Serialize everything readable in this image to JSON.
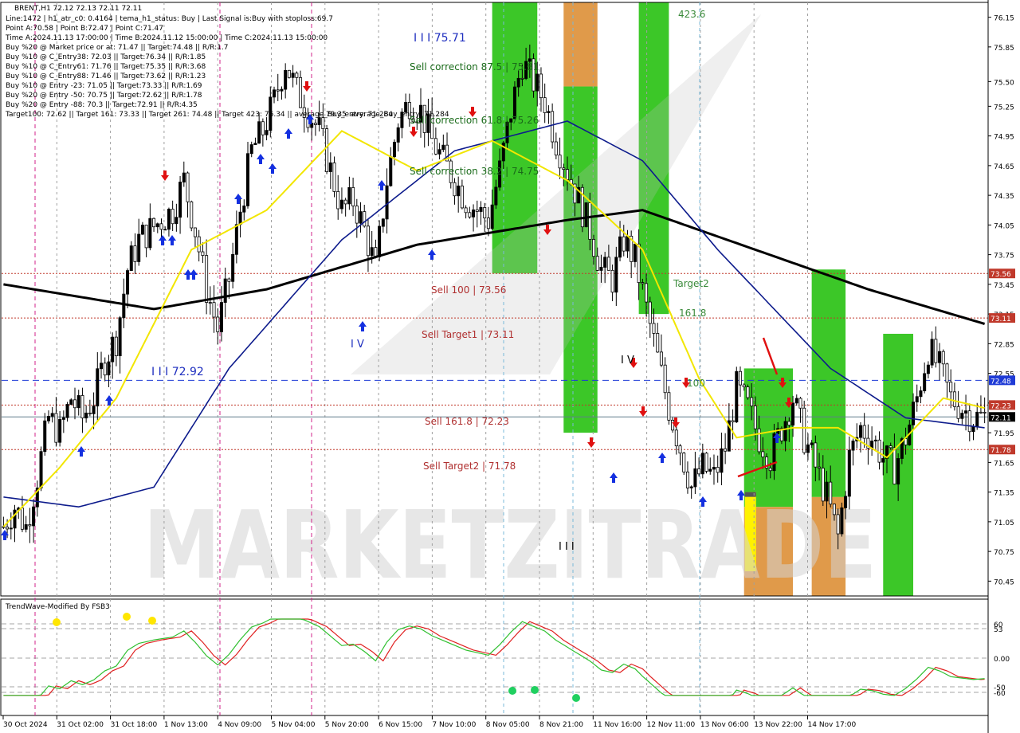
{
  "header": {
    "symbol_line": "BRENT,H1  72.12 72.13 72.11 72.11",
    "info_lines": [
      "Line:1472 | h1_atr_c0: 0.4164 | tema_h1_status: Buy | Last Signal is:Buy with stoploss:69.7",
      "Point A:70.58 | Point B:72.47 | Point C:71.47",
      "Time A:2024.11.13 17:00:00 | Time B:2024.11.12 15:00:00 | Time C:2024.11.13 15:00:00",
      "Buy %20 @ Market price or at: 71.47 || Target:74.48 || R/R:1.7",
      "Buy %10 @ C_Entry38: 72.03 || Target:76.34 || R/R:1.85",
      "Buy %10 @ C_Entry61: 71.76 || Target:75.35 || R/R:3.68",
      "Buy %10 @ C_Entry88: 71.46 || Target:73.62 || R/R:1.23",
      "Buy %10 @ Entry -23: 71.05 || Target:73.33 || R/R:1.69",
      "Buy %20 @ Entry -50: 70.75 || Target:72.62 || R/R:1.78",
      "Buy %20 @ Entry -88: 70.3 || Target:72.91 || R/R:4.35",
      "Target100: 72.62 || Target 161: 73.33 || Target 261: 74.48 || Target 423: 76.34 || average_Buy_entry: 71.284"
    ]
  },
  "watermark": "MARKETZITRADE",
  "annotations": {
    "sell_correction_875": "Sell correction 87.5 | 75.81",
    "sell_correction_618": "Sell correction 61.8 | 75.26",
    "sell_correction_382": "Sell correction 38.2 | 74.75",
    "sell_100": "Sell 100 | 73.56",
    "sell_target1": "Sell Target1 | 73.11",
    "sell_1618": "Sell 161.8 | 72.23",
    "sell_target2": "Sell Target2 | 71.78",
    "wave_iii_high": "I I I 75.71",
    "wave_iii_low": "I I I 72.92",
    "wave_iv_a": "I V",
    "wave_iv_b": "I V",
    "wave_iii_b": "I I I",
    "fib_4236": "423.6",
    "target2": "Target2",
    "fib_1618": "161.8",
    "fib_100": "100",
    "buy_stop_partial": "79.35",
    "average_buy_partial": "average_Buy_entry: 71.284"
  },
  "price_tags": [
    {
      "label": "73.56",
      "color": "#c0392b"
    },
    {
      "label": "73.11",
      "color": "#c0392b"
    },
    {
      "label": "72.48",
      "color": "#1f3bd6"
    },
    {
      "label": "72.23",
      "color": "#c0392b"
    },
    {
      "label": "72.11",
      "color": "#000000"
    },
    {
      "label": "71.78",
      "color": "#c0392b"
    }
  ],
  "oscillator": {
    "title": "TrendWave-Modified By FSB3",
    "levels": [
      "60",
      "53",
      "0.00",
      "-50",
      "-60"
    ]
  },
  "chart_data": {
    "type": "candlestick",
    "symbol": "BRENT",
    "timeframe": "H1",
    "ylim": [
      70.3,
      76.3
    ],
    "y_ticks": [
      "76.15",
      "75.85",
      "75.50",
      "75.25",
      "74.95",
      "74.65",
      "74.35",
      "74.05",
      "73.75",
      "73.45",
      "73.15",
      "72.85",
      "72.55",
      "72.25",
      "71.95",
      "71.65",
      "71.35",
      "71.05",
      "70.75",
      "70.45"
    ],
    "x_ticks": [
      "30 Oct 2024",
      "31 Oct 02:00",
      "31 Oct 18:00",
      "1 Nov 13:00",
      "4 Nov 09:00",
      "5 Nov 04:00",
      "5 Nov 20:00",
      "6 Nov 15:00",
      "7 Nov 10:00",
      "8 Nov 05:00",
      "8 Nov 21:00",
      "11 Nov 16:00",
      "12 Nov 11:00",
      "13 Nov 06:00",
      "13 Nov 22:00",
      "14 Nov 17:00"
    ],
    "levels": [
      {
        "name": "Sell 100",
        "value": 73.56,
        "color": "#c0392b",
        "style": "dotted"
      },
      {
        "name": "Sell Target1",
        "value": 73.11,
        "color": "#c0392b",
        "style": "dotted"
      },
      {
        "name": "Point B",
        "value": 72.48,
        "color": "#1f3bd6",
        "style": "dashed"
      },
      {
        "name": "Sell 161.8",
        "value": 72.23,
        "color": "#c0392b",
        "style": "dotted"
      },
      {
        "name": "Last price",
        "value": 72.11,
        "color": "#607d8b",
        "style": "solid"
      },
      {
        "name": "Sell Target2",
        "value": 71.78,
        "color": "#c0392b",
        "style": "dotted"
      }
    ],
    "close_path": [
      [
        0,
        71.0
      ],
      [
        3,
        71.2
      ],
      [
        6,
        71.0
      ],
      [
        9,
        71.5
      ],
      [
        12,
        72.1
      ],
      [
        15,
        71.95
      ],
      [
        18,
        72.3
      ],
      [
        21,
        72.1
      ],
      [
        24,
        72.3
      ],
      [
        27,
        72.7
      ],
      [
        30,
        72.9
      ],
      [
        33,
        73.6
      ],
      [
        36,
        73.9
      ],
      [
        39,
        74.0
      ],
      [
        42,
        74.1
      ],
      [
        45,
        74.2
      ],
      [
        48,
        74.5
      ],
      [
        51,
        74.0
      ],
      [
        54,
        73.4
      ],
      [
        57,
        73.0
      ],
      [
        60,
        73.5
      ],
      [
        63,
        74.2
      ],
      [
        66,
        74.8
      ],
      [
        69,
        75.0
      ],
      [
        72,
        75.3
      ],
      [
        75,
        75.7
      ],
      [
        78,
        75.4
      ],
      [
        81,
        75.2
      ],
      [
        84,
        75.0
      ],
      [
        87,
        74.6
      ],
      [
        90,
        74.2
      ],
      [
        93,
        74.3
      ],
      [
        96,
        74.0
      ],
      [
        99,
        73.6
      ],
      [
        102,
        74.5
      ],
      [
        105,
        75.1
      ],
      [
        108,
        75.3
      ],
      [
        111,
        75.2
      ],
      [
        114,
        74.9
      ],
      [
        117,
        74.7
      ],
      [
        120,
        74.5
      ],
      [
        123,
        74.3
      ],
      [
        126,
        74.2
      ],
      [
        129,
        74.1
      ],
      [
        132,
        74.6
      ],
      [
        135,
        75.2
      ],
      [
        138,
        75.7
      ],
      [
        141,
        75.5
      ],
      [
        144,
        75.3
      ],
      [
        147,
        74.9
      ],
      [
        150,
        74.6
      ],
      [
        153,
        74.3
      ],
      [
        156,
        74.0
      ],
      [
        159,
        73.6
      ],
      [
        162,
        73.5
      ],
      [
        165,
        73.9
      ],
      [
        168,
        73.7
      ],
      [
        171,
        73.2
      ],
      [
        174,
        72.7
      ],
      [
        177,
        72.2
      ],
      [
        180,
        71.8
      ],
      [
        183,
        71.4
      ],
      [
        186,
        71.6
      ],
      [
        189,
        71.5
      ],
      [
        192,
        71.8
      ],
      [
        195,
        72.4
      ],
      [
        198,
        72.2
      ],
      [
        201,
        71.9
      ],
      [
        204,
        71.7
      ],
      [
        207,
        72.0
      ],
      [
        210,
        72.3
      ],
      [
        213,
        71.9
      ],
      [
        216,
        71.6
      ],
      [
        219,
        71.3
      ],
      [
        222,
        70.9
      ],
      [
        225,
        71.7
      ],
      [
        228,
        72.0
      ],
      [
        231,
        71.9
      ],
      [
        234,
        71.7
      ],
      [
        237,
        71.6
      ],
      [
        240,
        71.9
      ],
      [
        243,
        72.3
      ],
      [
        246,
        72.8
      ],
      [
        249,
        72.6
      ],
      [
        252,
        72.3
      ],
      [
        255,
        72.2
      ],
      [
        258,
        72.1
      ],
      [
        261,
        72.11
      ]
    ],
    "moving_averages": [
      {
        "name": "slow MA",
        "color": "#000000",
        "points": [
          [
            0,
            73.45
          ],
          [
            40,
            73.2
          ],
          [
            70,
            73.4
          ],
          [
            110,
            73.85
          ],
          [
            150,
            74.1
          ],
          [
            170,
            74.2
          ],
          [
            200,
            73.8
          ],
          [
            230,
            73.4
          ],
          [
            261,
            73.05
          ]
        ]
      },
      {
        "name": "medium MA",
        "color": "#0d1b8c",
        "points": [
          [
            0,
            71.3
          ],
          [
            20,
            71.2
          ],
          [
            40,
            71.4
          ],
          [
            60,
            72.6
          ],
          [
            90,
            73.9
          ],
          [
            120,
            74.8
          ],
          [
            150,
            75.1
          ],
          [
            170,
            74.7
          ],
          [
            190,
            73.8
          ],
          [
            220,
            72.6
          ],
          [
            240,
            72.1
          ],
          [
            261,
            72.0
          ]
        ]
      },
      {
        "name": "fast TEMA",
        "color": "#f2e600",
        "points": [
          [
            0,
            71.0
          ],
          [
            15,
            71.6
          ],
          [
            30,
            72.3
          ],
          [
            50,
            73.8
          ],
          [
            70,
            74.2
          ],
          [
            90,
            75.0
          ],
          [
            110,
            74.6
          ],
          [
            130,
            74.9
          ],
          [
            150,
            74.5
          ],
          [
            170,
            73.8
          ],
          [
            185,
            72.5
          ],
          [
            195,
            71.9
          ],
          [
            210,
            72.0
          ],
          [
            222,
            72.0
          ],
          [
            235,
            71.7
          ],
          [
            250,
            72.3
          ],
          [
            261,
            72.2
          ]
        ]
      }
    ],
    "zones": [
      {
        "color": "#3cc728",
        "from_bar": 130,
        "to_bar": 142,
        "from": 73.56,
        "to": 76.3
      },
      {
        "color": "#e09a4a",
        "from_bar": 149,
        "to_bar": 158,
        "from": 75.45,
        "to": 76.3
      },
      {
        "color": "#3cc728",
        "from_bar": 149,
        "to_bar": 158,
        "from": 71.95,
        "to": 75.45
      },
      {
        "color": "#3cc728",
        "from_bar": 169,
        "to_bar": 177,
        "from": 73.15,
        "to": 76.3
      },
      {
        "color": "#3cc728",
        "from_bar": 197,
        "to_bar": 210,
        "from": 71.2,
        "to": 72.6
      },
      {
        "color": "#e09a4a",
        "from_bar": 197,
        "to_bar": 210,
        "from": 70.3,
        "to": 71.2
      },
      {
        "color": "#3cc728",
        "from_bar": 215,
        "to_bar": 224,
        "from": 71.3,
        "to": 73.6
      },
      {
        "color": "#e09a4a",
        "from_bar": 215,
        "to_bar": 224,
        "from": 70.3,
        "to": 71.3
      },
      {
        "color": "#3cc728",
        "from_bar": 234,
        "to_bar": 242,
        "from": 70.3,
        "to": 72.95
      }
    ]
  }
}
